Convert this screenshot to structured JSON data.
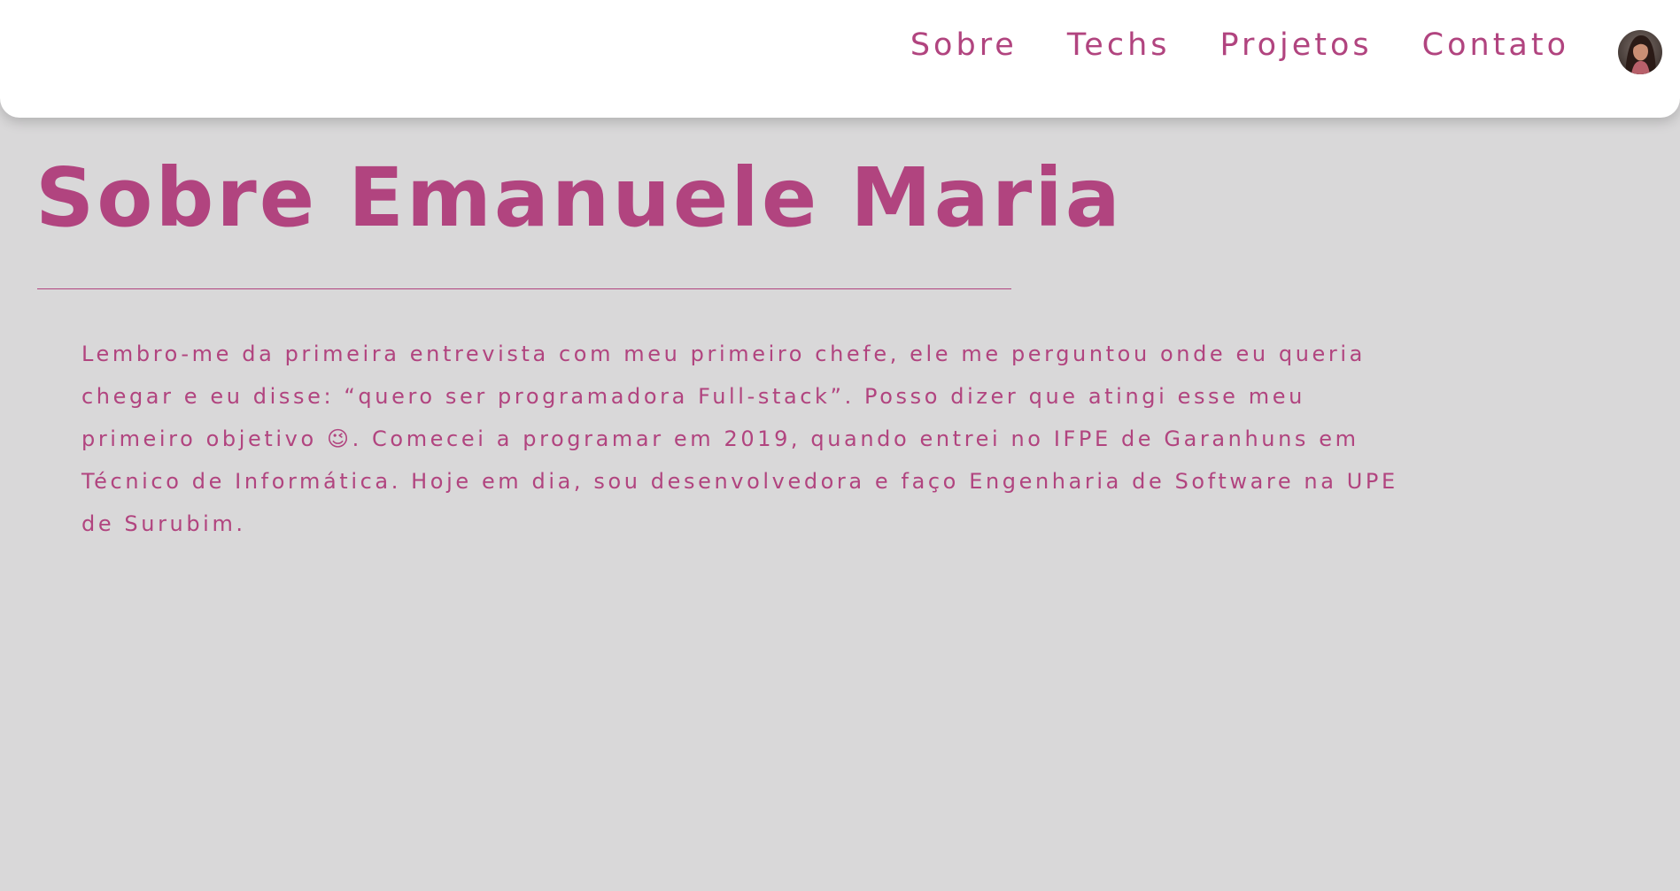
{
  "header": {
    "nav": [
      {
        "label": "Sobre"
      },
      {
        "label": "Techs"
      },
      {
        "label": "Projetos"
      },
      {
        "label": "Contato"
      }
    ]
  },
  "main": {
    "title": "Sobre Emanuele Maria",
    "paragraph": "Lembro-me da primeira entrevista com meu primeiro chefe, ele me perguntou onde eu queria chegar e eu disse: “quero ser programadora Full-stack”. Posso dizer que atingi esse meu primeiro objetivo 😉. Comecei a programar em 2019, quando entrei no IFPE de Garanhuns em Técnico de Informática. Hoje em dia, sou desenvolvedora e faço Engenharia de Software na UPE de Surubim."
  },
  "colors": {
    "accent": "#b1447f",
    "background": "#d9d8d9",
    "header_bg": "#ffffff"
  }
}
